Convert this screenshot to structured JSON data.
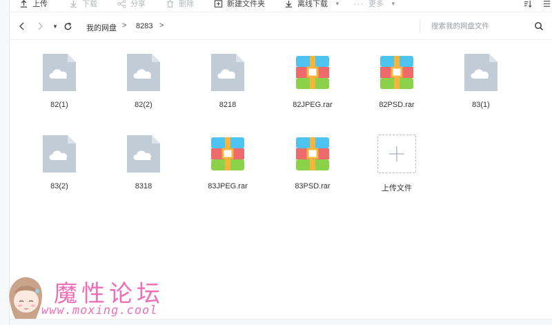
{
  "toolbar": {
    "upload_label": "上传",
    "download_label": "下载",
    "share_label": "分享",
    "delete_label": "删除",
    "new_folder_label": "新建文件夹",
    "offline_download_label": "离线下载",
    "more_label": "更多"
  },
  "nav": {
    "breadcrumb_root": "我的网盘",
    "breadcrumb_current": "8283",
    "separator": ">",
    "search_placeholder": "搜索我的网盘文件"
  },
  "files": [
    {
      "name": "82(1)",
      "type": "generic"
    },
    {
      "name": "82(2)",
      "type": "generic"
    },
    {
      "name": "8218",
      "type": "generic"
    },
    {
      "name": "82JPEG.rar",
      "type": "rar"
    },
    {
      "name": "82PSD.rar",
      "type": "rar"
    },
    {
      "name": "83(1)",
      "type": "generic"
    },
    {
      "name": "83(2)",
      "type": "generic"
    },
    {
      "name": "8318",
      "type": "generic"
    },
    {
      "name": "83JPEG.rar",
      "type": "rar"
    },
    {
      "name": "83PSD.rar",
      "type": "rar"
    }
  ],
  "upload_tile": {
    "label": "上传文件"
  },
  "watermark": {
    "text": "魔性论坛",
    "url": "www.moxing.cool"
  },
  "colors": {
    "generic_file": "#c2ccd6",
    "rar_blue": "#4fc3f0",
    "rar_red": "#ef6b6b",
    "rar_green": "#8bd24a",
    "rar_band": "#f6b53c",
    "watermark": "#ee6fb5"
  }
}
